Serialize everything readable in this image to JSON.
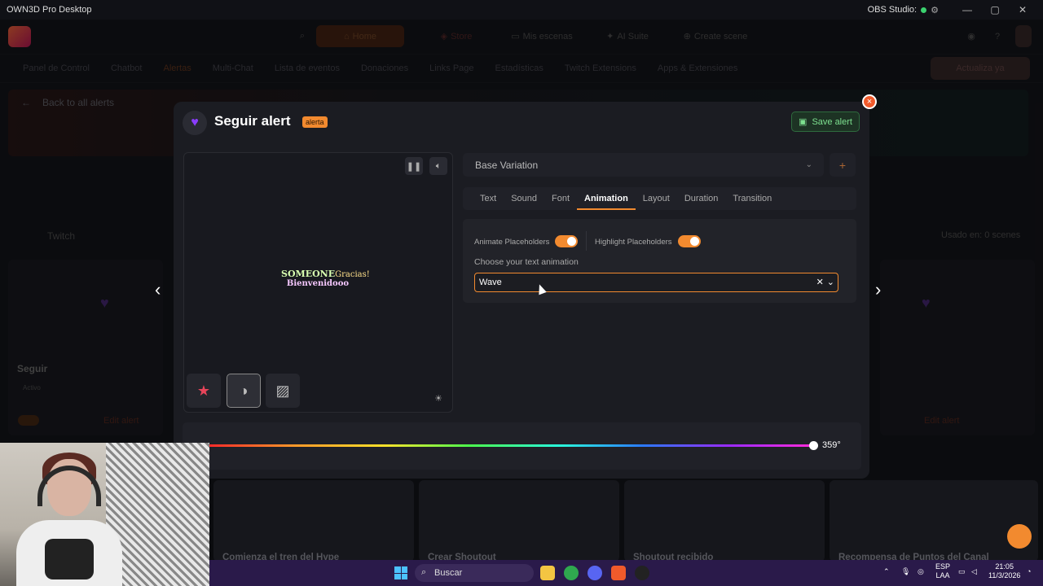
{
  "titlebar": {
    "app_title": "OWN3D Pro Desktop",
    "obs_label": "OBS Studio:",
    "obs_status_color": "#3bd16f",
    "controls": [
      "—",
      "▢",
      "✕"
    ]
  },
  "topnav": {
    "items": [
      "Home",
      "Store",
      "Mis escenas",
      "AI Suite",
      "Create scene"
    ]
  },
  "subnav": {
    "items": [
      "Panel de Control",
      "Chatbot",
      "Alertas",
      "Multi-Chat",
      "Lista de eventos",
      "Donaciones",
      "Links Page",
      "Estadísticas",
      "Twitch Extensions",
      "Apps & Extensiones"
    ],
    "update_label": "Actualiza ya"
  },
  "background": {
    "back_link": "Back to all alerts",
    "twitch_label": "Twitch",
    "used_in_label": "Usado en: 0 scenes",
    "seguir_label": "Seguir",
    "active_label": "Activo",
    "edit_alert": "Edit alert",
    "bottom_cards": [
      "Comienza el tren del Hype",
      "Crear Shoutout",
      "Shoutout recibido",
      "Recompensa de Puntos del Canal"
    ]
  },
  "modal": {
    "title": "Seguir alert",
    "tag": "alerta",
    "save_label": "Save alert",
    "close_icon": "×"
  },
  "preview": {
    "line1_a": "SOMEONE",
    "line1_b": "Gracias!",
    "line2": "Bienvenidooo"
  },
  "editor": {
    "variation": "Base Variation",
    "add_variation": "+",
    "tabs": [
      "Text",
      "Sound",
      "Font",
      "Animation",
      "Layout",
      "Duration",
      "Transition"
    ],
    "active_tab": "Animation",
    "animate_placeholders_label": "Animate Placeholders",
    "animate_placeholders_on": true,
    "highlight_placeholders_label": "Highlight Placeholders",
    "highlight_placeholders_on": true,
    "choose_label": "Choose your text animation",
    "animation_value": "Wave"
  },
  "hue": {
    "value": "359°",
    "degrees": 359
  },
  "taskbar": {
    "search_label": "Buscar",
    "lang_top": "ESP",
    "lang_bottom": "LAA",
    "time": "21:05",
    "date": "11/3/2026"
  },
  "colors": {
    "accent": "#f28a2f",
    "heart": "#8b3dff",
    "save_green": "#7de08f"
  }
}
